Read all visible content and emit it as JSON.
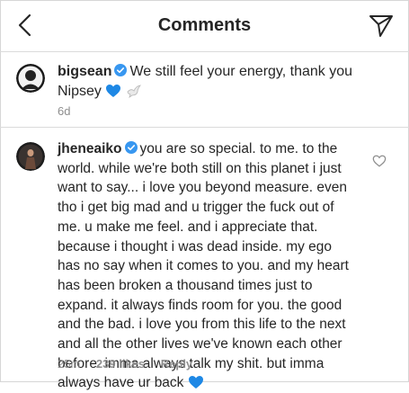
{
  "header": {
    "title": "Comments",
    "back_icon": "chevron-left-icon",
    "send_icon": "direct-send-icon"
  },
  "caption": {
    "username": "bigsean",
    "text": "We still feel your energy, thank you Nipsey",
    "emojis": [
      "blue-heart",
      "dove"
    ],
    "time": "6d"
  },
  "comment": {
    "username": "jheneaiko",
    "text": "you are so special. to me. to the world. while we're both still on this planet i just want to say... i love you beyond measure. even tho i get big mad and u trigger the fuck out of me. u make me feel. and i appreciate that. because i thought i was dead inside. my ego has no say when it comes to you. and my heart has been broken a thousand times just to expand. it always finds room for you. the good and the bad. i love you from this life to the next and all the other lives we've known each other before. imma always talk my shit. but imma always have ur back",
    "emojis": [
      "blue-heart"
    ],
    "time": "25m",
    "likes": "239 likes",
    "reply_label": "Reply"
  },
  "colors": {
    "verified": "#3897f0",
    "blue_heart": "#1e88e5",
    "muted": "#8e8e8e",
    "text": "#262626"
  }
}
